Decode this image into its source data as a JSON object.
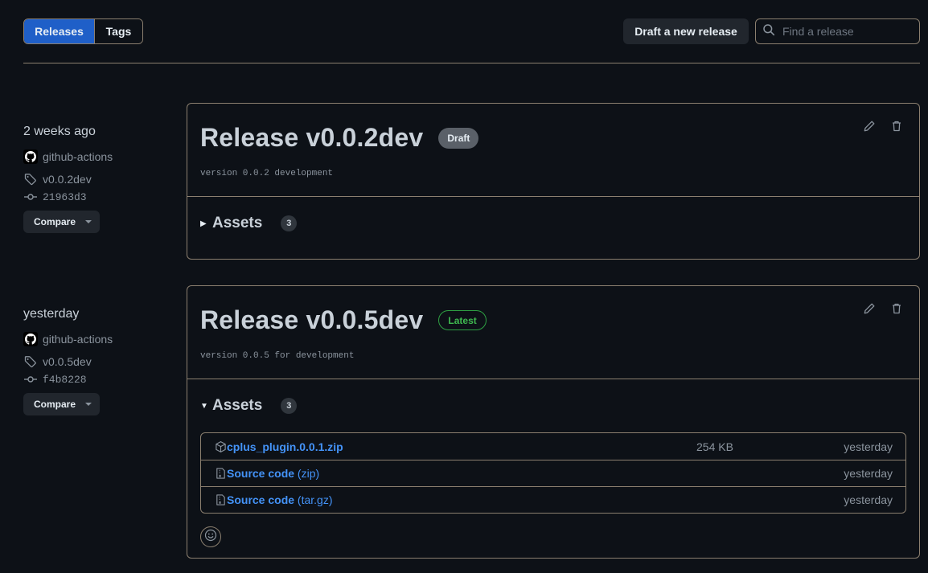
{
  "nav": {
    "tabs": [
      {
        "label": "Releases",
        "active": true
      },
      {
        "label": "Tags",
        "active": false
      }
    ],
    "draft_button": "Draft a new release",
    "search": {
      "placeholder": "Find a release",
      "value": "",
      "icon": "search-icon"
    }
  },
  "colors": {
    "accent": "#1f5fc8",
    "link": "#4493f8",
    "latest": "#3fb950",
    "background": "#0d1117",
    "border": "#8b7f6f"
  },
  "releases": [
    {
      "date": "2 weeks ago",
      "author": "github-actions",
      "tag": "v0.0.2dev",
      "commit": "21963d3",
      "compare_label": "Compare",
      "title": "Release v0.0.2dev",
      "badge": "Draft",
      "description": "version 0.0.2 development",
      "assets_label": "Assets",
      "assets_count": "3",
      "assets_expanded": false,
      "triangle": "▶",
      "assets": []
    },
    {
      "date": "yesterday",
      "author": "github-actions",
      "tag": "v0.0.5dev",
      "commit": "f4b8228",
      "compare_label": "Compare",
      "title": "Release v0.0.5dev",
      "badge": "Latest",
      "description": "version 0.0.5 for development",
      "assets_label": "Assets",
      "assets_count": "3",
      "assets_expanded": true,
      "triangle": "▼",
      "assets": [
        {
          "name": "cplus_plugin.0.0.1.zip",
          "suffix": "",
          "size": "254 KB",
          "date": "yesterday",
          "icon": "package-icon"
        },
        {
          "name": "Source code",
          "suffix": " (zip)",
          "size": "",
          "date": "yesterday",
          "icon": "file-zip-icon"
        },
        {
          "name": "Source code",
          "suffix": " (tar.gz)",
          "size": "",
          "date": "yesterday",
          "icon": "file-zip-icon"
        }
      ]
    }
  ]
}
